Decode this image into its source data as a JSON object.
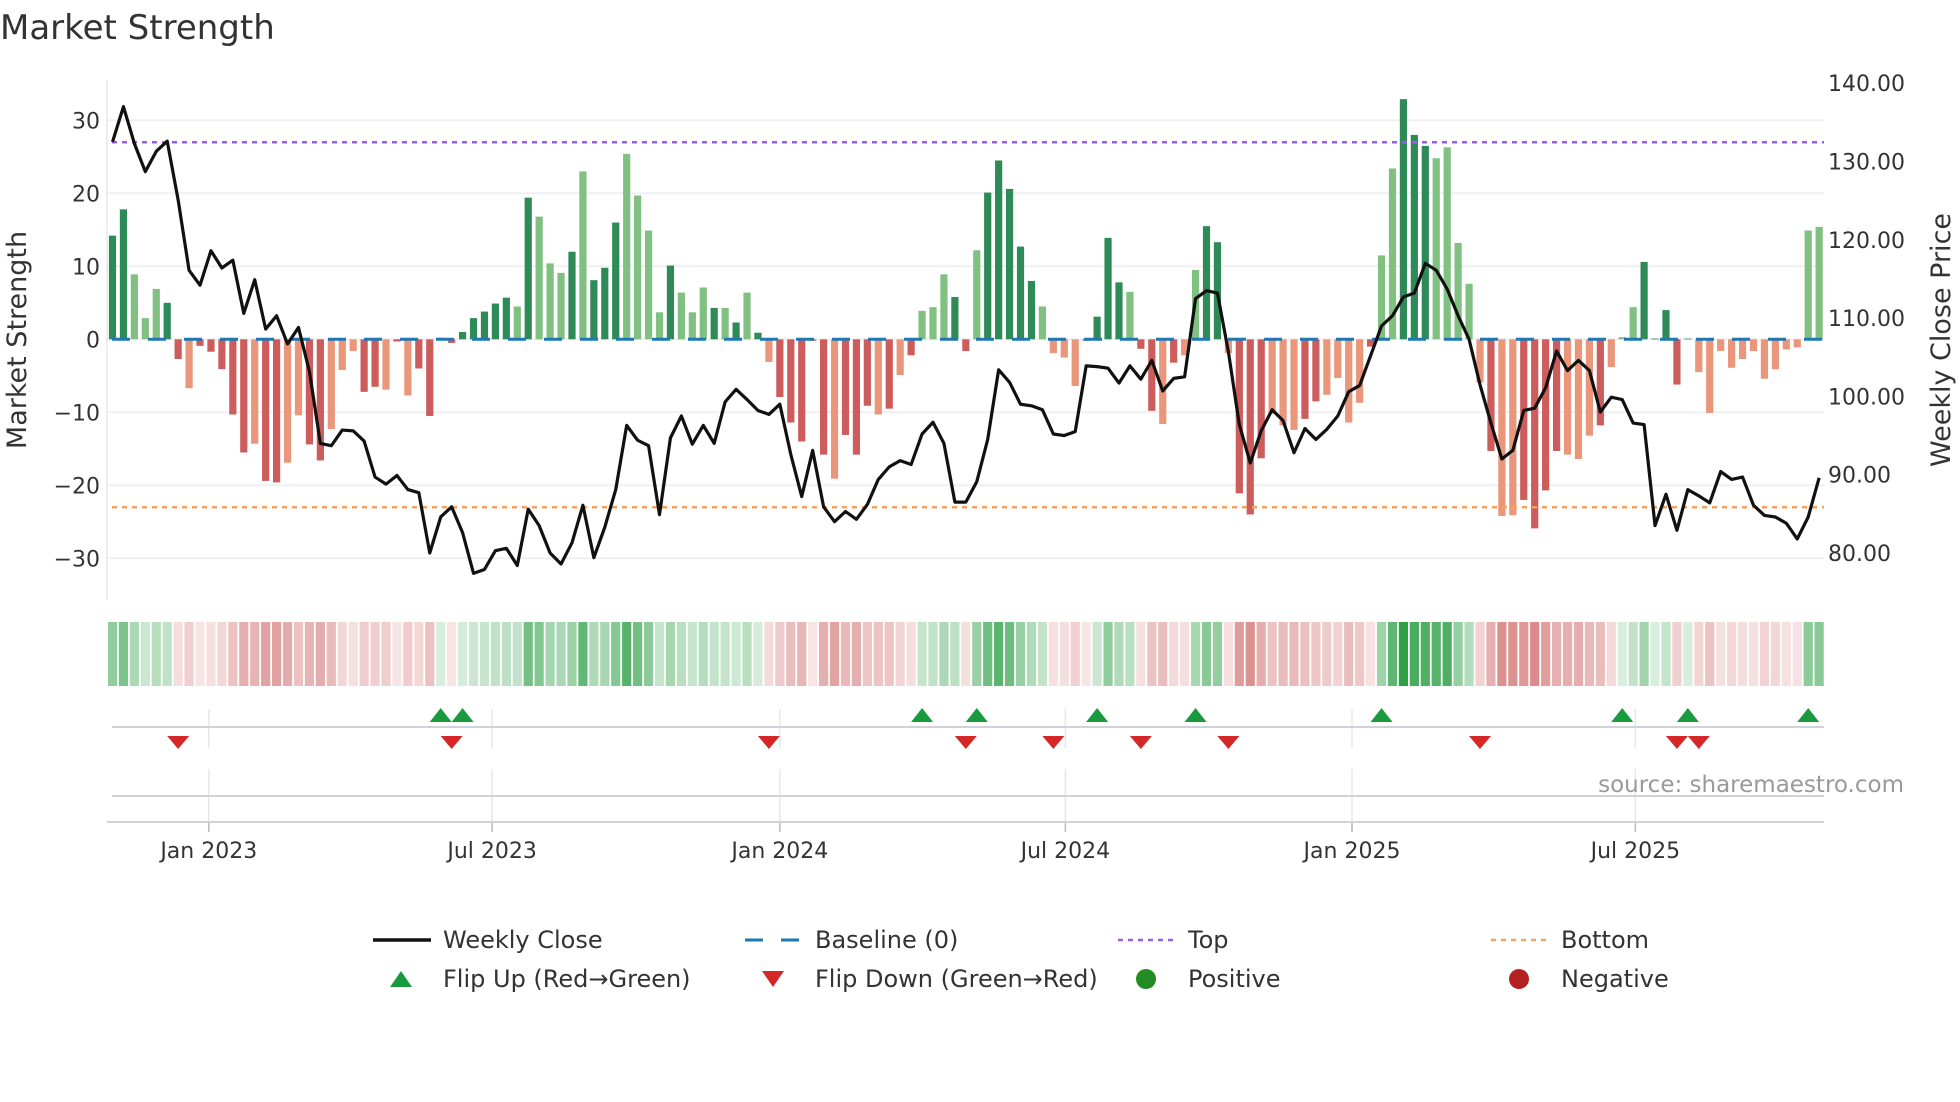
{
  "title": "Market Strength",
  "source": "source: sharemaestro.com",
  "colors": {
    "pos_strong": "#2e8b57",
    "pos_weak": "#80c080",
    "neg_strong": "#cd5c5c",
    "neg_weak": "#e9967a",
    "close": "#111111",
    "baseline": "#1f77b4",
    "top": "#9b5de5",
    "bottom": "#f4a460",
    "flip_up": "#1a9a3e",
    "flip_down": "#d62728",
    "positive": "#228b22",
    "negative": "#b22222"
  },
  "chart_data": {
    "type": "bar+line",
    "title": "Market Strength",
    "ylabel": "Market Strength",
    "y2label": "Weekly Close Price",
    "ylim": [
      -36,
      35
    ],
    "y2lim": [
      76,
      141
    ],
    "yticks": [
      "−30",
      "−20",
      "−10",
      "0",
      "10",
      "20",
      "30"
    ],
    "ytick_values": [
      -30,
      -20,
      -10,
      0,
      10,
      20,
      30
    ],
    "y2ticks": [
      "80.00",
      "90.00",
      "100.00",
      "110.00",
      "120.00",
      "130.00",
      "140.00"
    ],
    "y2tick_values": [
      80,
      90,
      100,
      110,
      120,
      130,
      140
    ],
    "xticks": [
      {
        "label": "Jan 2023",
        "week": 9.8
      },
      {
        "label": "Jul 2023",
        "week": 35.7
      },
      {
        "label": "Jan 2024",
        "week": 62.0
      },
      {
        "label": "Jul 2024",
        "week": 88.1
      },
      {
        "label": "Jan 2025",
        "week": 114.3
      },
      {
        "label": "Jul 2025",
        "week": 140.2
      }
    ],
    "top_level": 27,
    "bottom_level": -23,
    "baseline": 0,
    "strength": [
      14.2,
      17.8,
      8.9,
      2.9,
      6.9,
      5.0,
      -2.7,
      -6.7,
      -0.9,
      -1.7,
      -4.1,
      -10.3,
      -15.5,
      -14.3,
      -19.4,
      -19.6,
      -16.9,
      -10.4,
      -14.4,
      -16.6,
      -12.3,
      -4.2,
      -1.6,
      -7.2,
      -6.5,
      -6.9,
      -0.3,
      -7.7,
      -4.0,
      -10.5,
      0.2,
      -0.5,
      1.0,
      2.9,
      3.8,
      4.9,
      5.7,
      4.5,
      19.4,
      16.8,
      10.4,
      9.1,
      12.0,
      23.0,
      8.1,
      9.8,
      16.0,
      25.4,
      19.7,
      14.9,
      3.7,
      10.1,
      6.4,
      3.7,
      7.1,
      4.3,
      4.3,
      2.3,
      6.4,
      0.9,
      -3.1,
      -7.9,
      -11.4,
      -14.0,
      -0.2,
      -15.8,
      -19.1,
      -13.1,
      -15.8,
      -9.1,
      -10.3,
      -9.5,
      -4.9,
      -2.2,
      3.9,
      4.4,
      8.9,
      5.8,
      -1.6,
      12.2,
      20.1,
      24.5,
      20.6,
      12.7,
      8.0,
      4.5,
      -1.9,
      -2.5,
      -6.4,
      -0.2,
      3.1,
      13.9,
      7.8,
      6.5,
      -1.3,
      -9.8,
      -11.6,
      -3.2,
      -2.2,
      9.5,
      15.5,
      13.3,
      -1.9,
      -21.1,
      -24.0,
      -16.3,
      -10.2,
      -11.8,
      -12.4,
      -10.9,
      -8.5,
      -7.6,
      -5.3,
      -11.4,
      -8.7,
      -1.0,
      11.5,
      23.4,
      32.9,
      28.0,
      26.5,
      24.8,
      26.3,
      13.2,
      7.6,
      -5.9,
      -15.3,
      -24.2,
      -24.1,
      -22.0,
      -25.9,
      -20.7,
      -15.3,
      -15.8,
      -16.4,
      -13.2,
      -11.8,
      -3.8,
      0.3,
      4.4,
      10.6,
      0.1,
      4.0,
      -6.2,
      0.1,
      -4.5,
      -10.1,
      -1.6,
      -3.9,
      -2.7,
      -1.6,
      -5.4,
      -4.1,
      -1.4,
      -1.1,
      14.9,
      15.4
    ],
    "shade": "ddlllddldddddlddllddlllddldldddddddddldllldldddlllldllldldldldddddldddldldlllddldddddllllddddlddldllddldddlllddlllldlldddllllldllddddllldlllddddd",
    "close": [
      132.5,
      137.0,
      132.3,
      128.7,
      131.3,
      132.6,
      125.1,
      116.1,
      114.2,
      118.6,
      116.4,
      117.4,
      110.6,
      114.9,
      108.6,
      110.3,
      106.7,
      108.8,
      103.2,
      94.0,
      93.7,
      95.7,
      95.6,
      94.3,
      89.7,
      88.8,
      89.9,
      88.1,
      87.7,
      80.0,
      84.6,
      85.9,
      82.6,
      77.4,
      77.9,
      80.3,
      80.6,
      78.4,
      85.6,
      83.5,
      80.0,
      78.6,
      81.3,
      86.1,
      79.4,
      83.3,
      88.1,
      96.3,
      94.4,
      93.7,
      84.9,
      94.7,
      97.5,
      93.9,
      96.3,
      94.0,
      99.3,
      100.9,
      99.6,
      98.2,
      97.7,
      99.0,
      92.6,
      87.2,
      93.1,
      85.9,
      84.0,
      85.3,
      84.3,
      86.2,
      89.4,
      91.0,
      91.8,
      91.3,
      95.2,
      96.7,
      94.0,
      86.5,
      86.5,
      89.1,
      94.5,
      103.4,
      101.8,
      99.0,
      98.8,
      98.3,
      95.2,
      95.0,
      95.5,
      103.9,
      103.8,
      103.6,
      101.7,
      103.9,
      102.2,
      104.6,
      100.7,
      102.3,
      102.5,
      112.5,
      113.5,
      113.2,
      105.7,
      96.4,
      91.5,
      95.6,
      98.3,
      96.9,
      92.8,
      95.9,
      94.5,
      95.8,
      97.5,
      100.6,
      101.4,
      105.2,
      109.0,
      110.3,
      112.7,
      113.2,
      117.0,
      116.1,
      113.7,
      110.3,
      107.3,
      101.5,
      96.6,
      92.0,
      93.1,
      98.2,
      98.5,
      101.1,
      105.8,
      103.3,
      104.6,
      103.3,
      98.0,
      99.9,
      99.6,
      96.6,
      96.4,
      83.5,
      87.5,
      82.9,
      88.1,
      87.3,
      86.4,
      90.4,
      89.4,
      89.7,
      86.1,
      84.8,
      84.6,
      83.8,
      81.8,
      84.6,
      89.6
    ],
    "flip_up_weeks": [
      31,
      33,
      75,
      80,
      91,
      100,
      117,
      139,
      145,
      156
    ],
    "flip_down_weeks": [
      7,
      32,
      61,
      79,
      87,
      95,
      103,
      126,
      144,
      146
    ],
    "legend": [
      {
        "key": "close",
        "label": "Weekly Close"
      },
      {
        "key": "baseline",
        "label": "Baseline (0)"
      },
      {
        "key": "top",
        "label": "Top"
      },
      {
        "key": "bottom",
        "label": "Bottom"
      },
      {
        "key": "flip_up",
        "label": "Flip Up (Red→Green)"
      },
      {
        "key": "flip_down",
        "label": "Flip Down (Green→Red)"
      },
      {
        "key": "positive",
        "label": "Positive"
      },
      {
        "key": "negative",
        "label": "Negative"
      }
    ],
    "legend_position": "bottom"
  }
}
